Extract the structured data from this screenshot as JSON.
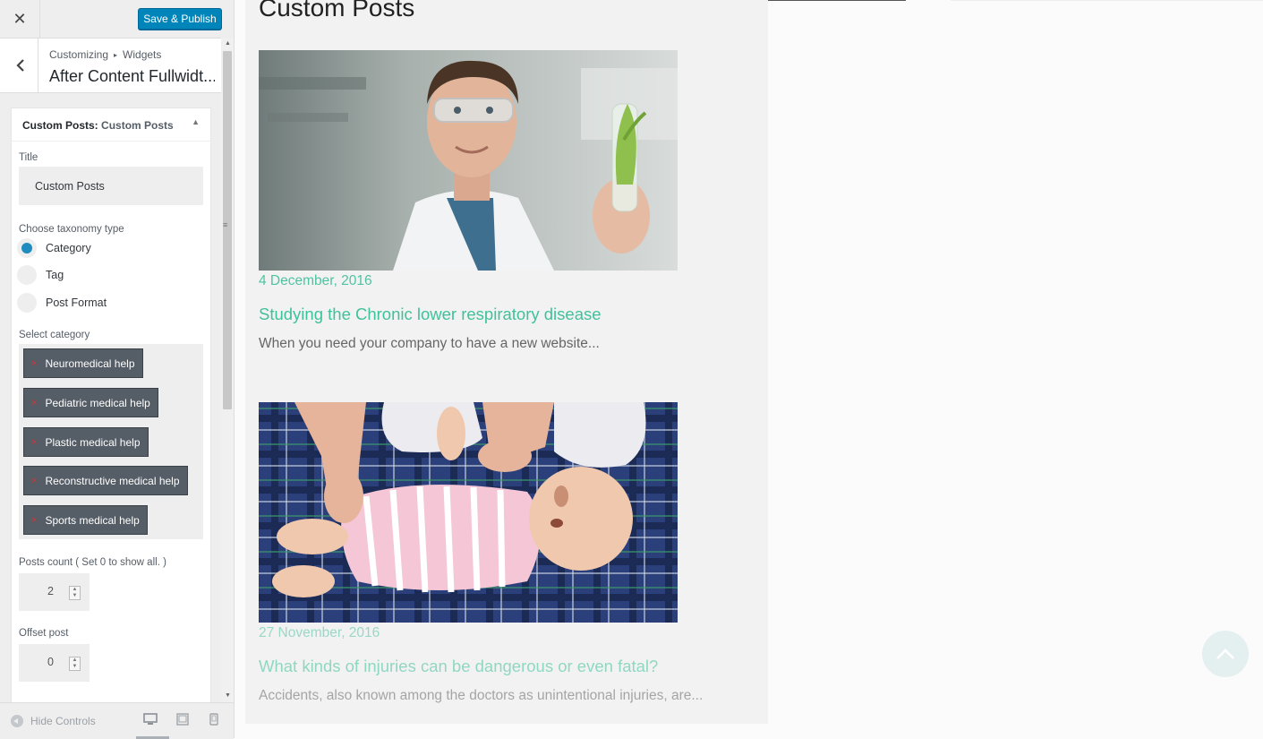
{
  "header": {
    "close_label": "✕",
    "save_label": "Save & Publish"
  },
  "breadcrumb": {
    "parent": "Customizing",
    "separator": "▸",
    "current": "Widgets",
    "section_title": "After Content Fullwidt..."
  },
  "widget": {
    "title_prefix": "Custom Posts:",
    "title_name": "Custom Posts",
    "toggle_icon": "▲",
    "title_label": "Title",
    "title_value": "Custom Posts",
    "taxonomy_label": "Choose taxonomy type",
    "taxonomy_options": [
      {
        "label": "Category",
        "selected": true
      },
      {
        "label": "Tag",
        "selected": false
      },
      {
        "label": "Post Format",
        "selected": false
      }
    ],
    "category_label": "Select category",
    "categories": [
      "Neuromedical help",
      "Pediatric medical help",
      "Plastic medical help",
      "Reconstructive medical help",
      "Sports medical help"
    ],
    "remove_icon": "×",
    "posts_count_label": "Posts count ( Set 0 to show all. )",
    "posts_count_value": "2",
    "offset_label": "Offset post",
    "offset_value": "0"
  },
  "footer": {
    "hide_controls_label": "Hide Controls"
  },
  "preview": {
    "section_title": "Custom Posts",
    "posts": [
      {
        "date": "4 December, 2016",
        "title": "Studying the Chronic lower respiratory disease",
        "excerpt": "When you need your company to have a new website..."
      },
      {
        "date": "27 November, 2016",
        "title": "What kinds of injuries can be dangerous or even fatal?",
        "excerpt": "Accidents, also known among the doctors as unintentional injuries, are..."
      }
    ]
  },
  "colors": {
    "accent": "#0085ba",
    "post_title": "#3fc29a",
    "chip_bg": "#555d66",
    "remove_x": "#dc3232"
  },
  "icons": [
    "close-icon",
    "back-arrow-icon",
    "collapse-arrow-icon",
    "hide-controls-icon",
    "desktop-icon",
    "tablet-icon",
    "mobile-icon",
    "scroll-to-top-icon"
  ]
}
